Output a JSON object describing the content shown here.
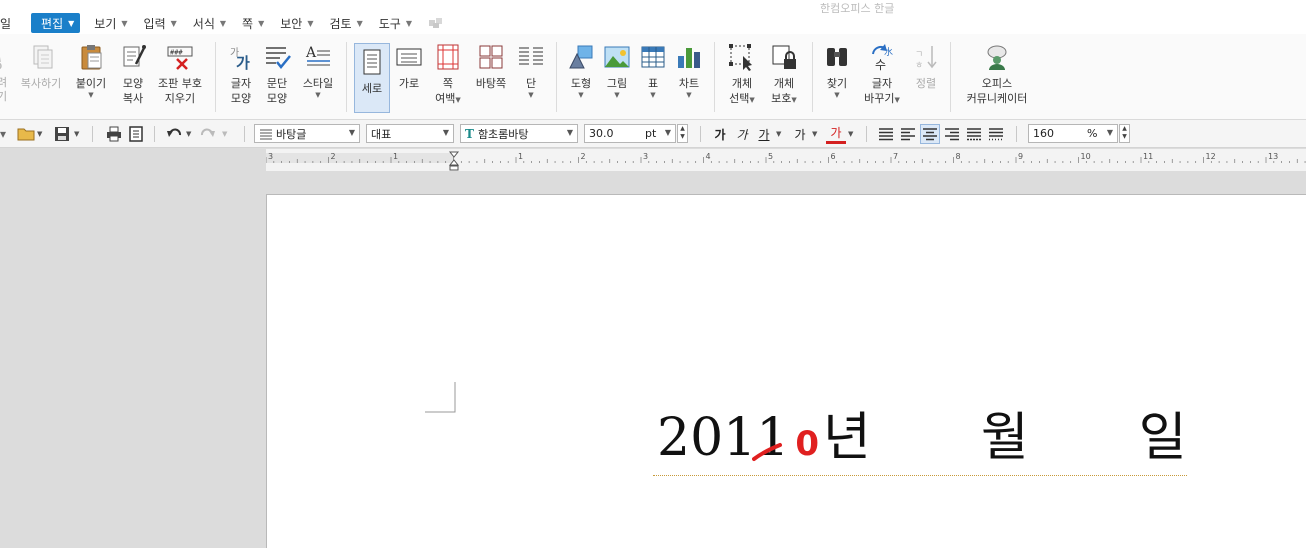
{
  "title": "한컴오피스 한글",
  "menu": {
    "partial": "일",
    "items": [
      {
        "label": "편집",
        "active": true
      },
      {
        "label": "보기"
      },
      {
        "label": "입력"
      },
      {
        "label": "서식"
      },
      {
        "label": "쪽"
      },
      {
        "label": "보안"
      },
      {
        "label": "검토"
      },
      {
        "label": "도구"
      }
    ]
  },
  "ribbon": {
    "cut_partial": [
      "려",
      "기"
    ],
    "copy": "복사하기",
    "paste": "붙이기",
    "format_copy": [
      "모양",
      "복사"
    ],
    "layout_mark": [
      "조판 부호",
      "지우기"
    ],
    "char_shape": [
      "글자",
      "모양"
    ],
    "para_shape": [
      "문단",
      "모양"
    ],
    "style": "스타일",
    "vertical": "세로",
    "horizontal": "가로",
    "page_margin": [
      "쪽",
      "여백"
    ],
    "master_page": "바탕쪽",
    "column": "단",
    "shape": "도형",
    "picture": "그림",
    "table": "표",
    "chart": "차트",
    "obj_select": [
      "개체",
      "선택"
    ],
    "obj_protect": [
      "개체",
      "보호"
    ],
    "find": "찾기",
    "replace": [
      "글자",
      "바꾸기"
    ],
    "sort": "정렬",
    "communicator": [
      "오피스",
      "커뮤니케이터"
    ]
  },
  "format_bar": {
    "style": "바탕글",
    "lang": "대표",
    "font": "함초롬바탕",
    "size": "30.0",
    "size_unit": "pt",
    "bold": "가",
    "italic": "가",
    "underline": "가",
    "strike": "가",
    "color": "가",
    "zoom": "160",
    "zoom_unit": "%"
  },
  "ruler": {
    "marks": [
      "3",
      "2",
      "1",
      "1",
      "2",
      "3",
      "4",
      "5",
      "6",
      "7",
      "8",
      "9",
      "10",
      "11",
      "12",
      "13"
    ]
  },
  "document": {
    "year_prefix": "201",
    "year_strike": "1",
    "year_correction": "0",
    "text_year": "년",
    "text_month": "월",
    "text_day": "일"
  },
  "colors": {
    "accent": "#1a7fc9",
    "correction": "#e02020"
  }
}
